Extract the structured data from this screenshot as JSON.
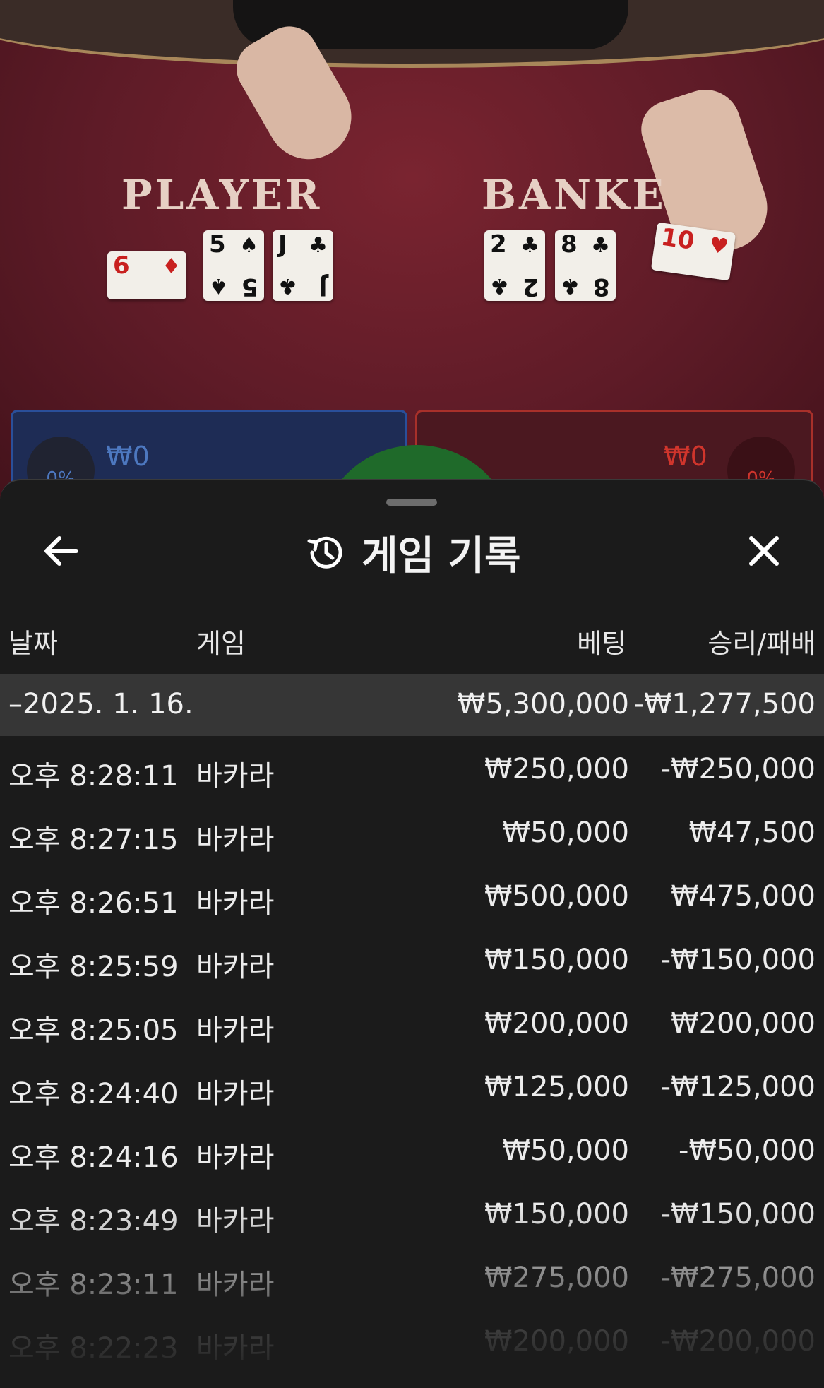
{
  "table": {
    "player_label": "PLAYER",
    "banker_label": "BANKE",
    "player_cards": [
      {
        "rank": "6",
        "suit": "♦",
        "color": "red"
      },
      {
        "rank": "5",
        "suit": "♠",
        "color": "black"
      },
      {
        "rank": "J",
        "suit": "♣",
        "color": "black"
      }
    ],
    "banker_cards": [
      {
        "rank": "2",
        "suit": "♣",
        "color": "black"
      },
      {
        "rank": "8",
        "suit": "♣",
        "color": "black"
      },
      {
        "rank": "10",
        "suit": "♥",
        "color": "red"
      }
    ],
    "player_bet_pct": "0%",
    "player_bet_amount": "₩0",
    "banker_bet_pct": "0%",
    "banker_bet_amount": "₩0"
  },
  "panel": {
    "title": "게임 기록",
    "back_icon": "arrow-left-icon",
    "history_icon": "history-clock-icon",
    "close_icon": "close-icon",
    "columns": {
      "date": "날짜",
      "game": "게임",
      "bet": "베팅",
      "win_loss": "승리/패배"
    },
    "summary": {
      "date": "–2025. 1. 16.",
      "bet": "₩5,300,000",
      "win_loss": "-₩1,277,500"
    },
    "rows": [
      {
        "time": "오후 8:28:11",
        "game": "바카라",
        "bet": "₩250,000",
        "result": "-₩250,000"
      },
      {
        "time": "오후 8:27:15",
        "game": "바카라",
        "bet": "₩50,000",
        "result": "₩47,500"
      },
      {
        "time": "오후 8:26:51",
        "game": "바카라",
        "bet": "₩500,000",
        "result": "₩475,000"
      },
      {
        "time": "오후 8:25:59",
        "game": "바카라",
        "bet": "₩150,000",
        "result": "-₩150,000"
      },
      {
        "time": "오후 8:25:05",
        "game": "바카라",
        "bet": "₩200,000",
        "result": "₩200,000"
      },
      {
        "time": "오후 8:24:40",
        "game": "바카라",
        "bet": "₩125,000",
        "result": "-₩125,000"
      },
      {
        "time": "오후 8:24:16",
        "game": "바카라",
        "bet": "₩50,000",
        "result": "-₩50,000"
      },
      {
        "time": "오후 8:23:49",
        "game": "바카라",
        "bet": "₩150,000",
        "result": "-₩150,000"
      },
      {
        "time": "오후 8:23:11",
        "game": "바카라",
        "bet": "₩275,000",
        "result": "-₩275,000"
      },
      {
        "time": "오후 8:22:23",
        "game": "바카라",
        "bet": "₩200,000",
        "result": "-₩200,000"
      }
    ]
  },
  "colors": {
    "player_blue": "#4d78c0",
    "banker_red": "#d0352c",
    "panel_bg": "#1b1b1b",
    "summary_bg": "#363636"
  }
}
